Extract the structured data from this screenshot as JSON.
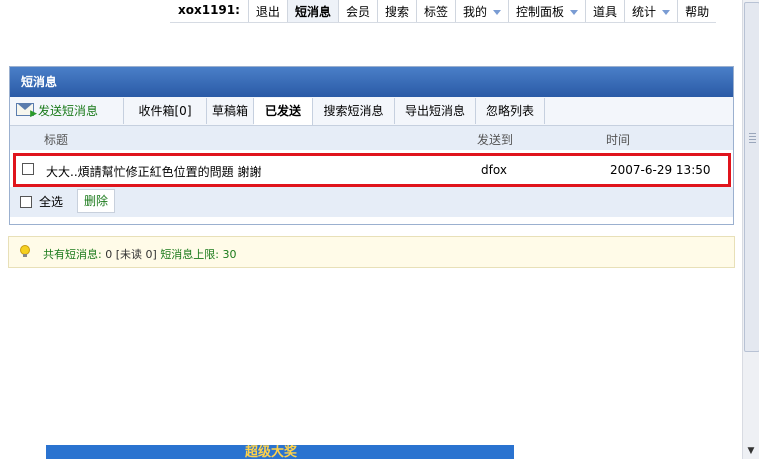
{
  "topnav": {
    "username": "xox1191:",
    "items": [
      "退出",
      "短消息",
      "会员",
      "搜索",
      "标签",
      "我的",
      "控制面板",
      "道具",
      "统计",
      "帮助"
    ],
    "active": "短消息"
  },
  "panel": {
    "title": "短消息",
    "tabs": [
      "发送短消息",
      "收件箱[0]",
      "草稿箱",
      "已发送",
      "搜索短消息",
      "导出短消息",
      "忽略列表"
    ],
    "active_tab": "已发送",
    "columns": [
      "标题",
      "发送到",
      "时间"
    ],
    "messages": [
      {
        "title": "大大..煩請幫忙修正紅色位置的問題 謝謝",
        "to": "dfox",
        "time": "2007-6-29 13:50"
      }
    ],
    "select_all_label": "全选",
    "delete_label": "删除"
  },
  "notice": {
    "total_label": "共有短消息:",
    "total": "0",
    "unread_open": "[未读",
    "unread": "0]",
    "limit_label": "短消息上限:",
    "limit": "30"
  },
  "banner": {
    "text": "超级大奖"
  },
  "colors": {
    "header_blue": "#2a5aa6",
    "highlight_red": "#e0141c",
    "link_green": "#1a7a1a"
  }
}
